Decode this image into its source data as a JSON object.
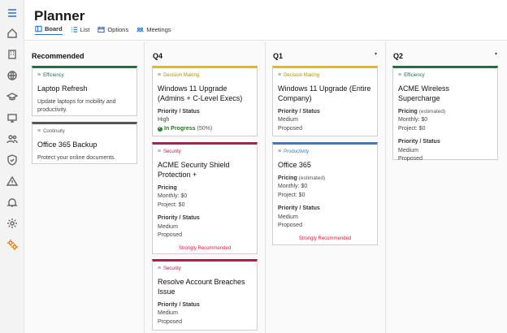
{
  "app": {
    "title": "Planner"
  },
  "tabs": [
    {
      "label": "Board",
      "icon": "board-icon",
      "active": true
    },
    {
      "label": "List",
      "icon": "list-icon",
      "active": false
    },
    {
      "label": "Options",
      "icon": "options-icon",
      "active": false
    },
    {
      "label": "Meetings",
      "icon": "meetings-icon",
      "active": false
    }
  ],
  "rail_icons": [
    "menu-icon",
    "home-icon",
    "building-icon",
    "globe-icon",
    "graduation-cap-icon",
    "monitor-icon",
    "people-icon",
    "shield-icon",
    "warning-icon",
    "bell-icon",
    "gear-icon",
    "settings-active-icon"
  ],
  "colors": {
    "efficiency": "#1e7145",
    "continuity": "#555555",
    "decision": "#e8b900",
    "security": "#c0174a",
    "productivity": "#2a7fd4",
    "accent": "#2a6fd6",
    "strong": "#d21f3c"
  },
  "columns": {
    "recommended": {
      "title": "Recommended",
      "cards": [
        {
          "tag": "Efficiency",
          "title": "Laptop Refresh",
          "desc": "Update laptops for mobility and productivity."
        },
        {
          "tag": "Continuity",
          "title": "Office 365 Backup",
          "desc": "Protect your online documents."
        }
      ]
    },
    "q4": {
      "title": "Q4",
      "cards": [
        {
          "tag": "Decision Making",
          "title": "Windows 11 Upgrade (Admins + C-Level Execs)",
          "ps_label": "Priority / Status",
          "priority": "High",
          "status": "In Progress",
          "pct": "(50%)"
        },
        {
          "tag": "Security",
          "title": "ACME Security Shield Protection +",
          "pricing_label": "Pricing",
          "monthly": "Monthly: $0",
          "project": "Project: $0",
          "ps_label": "Priority / Status",
          "priority": "Medium",
          "status": "Proposed",
          "strong": "Strongly Recommended"
        },
        {
          "tag": "Security",
          "title": "Resolve Account Breaches Issue",
          "ps_label": "Priority / Status",
          "priority": "Medium",
          "status": "Proposed"
        }
      ]
    },
    "q1": {
      "title": "Q1",
      "cards": [
        {
          "tag": "Decision Making",
          "title": "Windows 11 Upgrade (Entire Company)",
          "ps_label": "Priority / Status",
          "priority": "Medium",
          "status": "Proposed"
        },
        {
          "tag": "Productivity",
          "title": "Office 365",
          "pricing_label": "Pricing",
          "pricing_note": "(estimated)",
          "monthly": "Monthly: $0",
          "project": "Project: $0",
          "ps_label": "Priority / Status",
          "priority": "Medium",
          "status": "Proposed",
          "strong": "Strongly Recommended"
        }
      ]
    },
    "q2": {
      "title": "Q2",
      "cards": [
        {
          "tag": "Efficiency",
          "title": "ACME Wireless Supercharge",
          "pricing_label": "Pricing",
          "pricing_note": "(estimated)",
          "monthly": "Monthly: $0",
          "project": "Project: $0",
          "ps_label": "Priority / Status",
          "priority": "Medium",
          "status": "Proposed"
        }
      ]
    }
  }
}
